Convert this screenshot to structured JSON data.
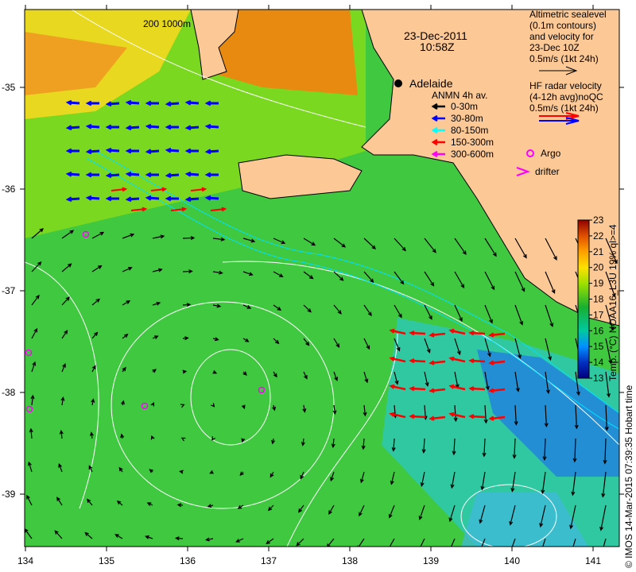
{
  "map": {
    "date": "23-Dec-2011",
    "time": "10:58Z",
    "scale_bar": "200  1000m",
    "city": "Adelaide",
    "lon_ticks": [
      "134",
      "135",
      "136",
      "137",
      "138",
      "139",
      "140",
      "141"
    ],
    "lat_ticks": [
      "-35",
      "-36",
      "-37",
      "-38",
      "-39"
    ]
  },
  "legend": {
    "altimetry": [
      "Altimetric sealevel",
      "(0.1m contours)",
      "and velocity for",
      "23-Dec 10Z",
      "0.5m/s (1kt 24h)"
    ],
    "hf_radar": [
      "HF radar velocity",
      "(4-12h avg)noQC",
      "0.5m/s (1kt 24h)"
    ],
    "anmn_title": "ANMN 4h av.",
    "anmn_items": [
      {
        "label": "0-30m",
        "color": "#000000"
      },
      {
        "label": "30-80m",
        "color": "#0000ff"
      },
      {
        "label": "80-150m",
        "color": "#00ffff"
      },
      {
        "label": "150-300m",
        "color": "#ff0000"
      },
      {
        "label": "300-600m",
        "color": "#ff00ff"
      }
    ],
    "argo": "Argo",
    "drifter": "drifter"
  },
  "colorbar": {
    "ticks": [
      "13",
      "14",
      "15",
      "16",
      "17",
      "18",
      "19",
      "20",
      "21",
      "22",
      "23"
    ],
    "label": "Temp. (°C) NOAA16_L3U 19% ql>=4",
    "range": [
      13,
      23
    ]
  },
  "credit": "© IMOS 14-Mar-2015 07:39:35 Hobart time"
}
